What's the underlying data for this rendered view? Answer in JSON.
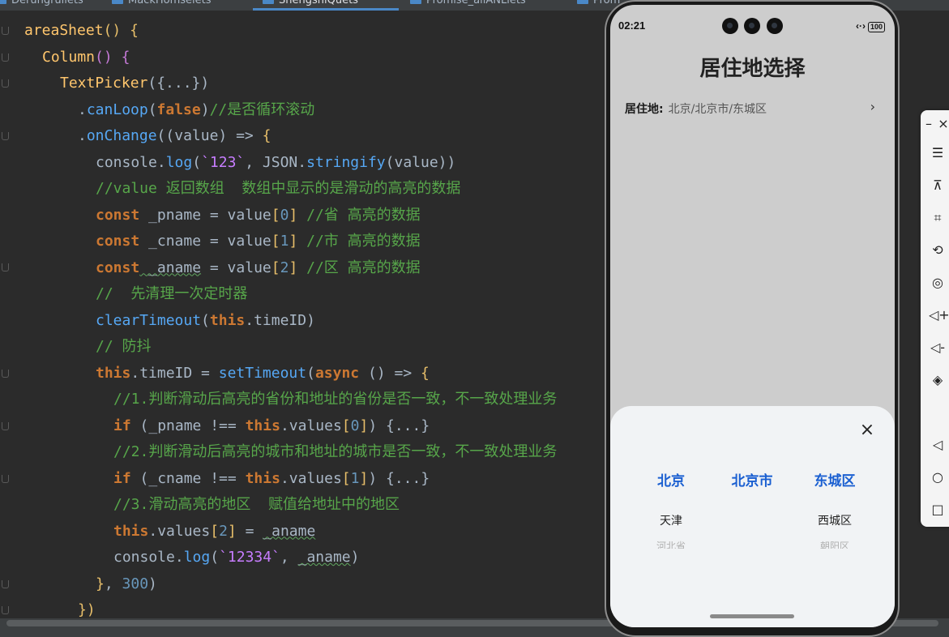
{
  "editor": {
    "tabs": [
      {
        "label": "Derungruilets"
      },
      {
        "label": "MackHomselets"
      },
      {
        "label": "ShengshiQuets"
      },
      {
        "label": "Promise_allANLlets"
      },
      {
        "label": "Prom"
      }
    ],
    "lines": [
      {
        "indent": 1,
        "tokens": [
          [
            "fn",
            "areaSheet"
          ],
          [
            "br1",
            "()"
          ],
          [
            "",
            " "
          ],
          [
            "br1",
            "{"
          ]
        ]
      },
      {
        "indent": 2,
        "tokens": [
          [
            "fn",
            "Column"
          ],
          [
            "br2",
            "()"
          ],
          [
            "",
            " "
          ],
          [
            "br2",
            "{"
          ]
        ]
      },
      {
        "indent": 3,
        "tokens": [
          [
            "fn",
            "TextPicker"
          ],
          [
            "",
            "({...})"
          ]
        ]
      },
      {
        "indent": 4,
        "tokens": [
          [
            "",
            "."
          ],
          [
            "mth",
            "canLoop"
          ],
          [
            "",
            "("
          ],
          [
            "kw",
            "false"
          ],
          [
            "",
            ")"
          ],
          [
            "cm",
            "//是否循环滚动"
          ]
        ]
      },
      {
        "indent": 4,
        "tokens": [
          [
            "",
            "."
          ],
          [
            "mth",
            "onChange"
          ],
          [
            "",
            "(("
          ],
          [
            "",
            "value"
          ],
          [
            "",
            ") => "
          ],
          [
            "br1",
            "{"
          ]
        ]
      },
      {
        "indent": 5,
        "tokens": [
          [
            "",
            "console."
          ],
          [
            "mth",
            "log"
          ],
          [
            "",
            "("
          ],
          [
            "str",
            "`123`"
          ],
          [
            "",
            ", JSON."
          ],
          [
            "mth",
            "stringify"
          ],
          [
            "",
            "(value))"
          ]
        ]
      },
      {
        "indent": 5,
        "tokens": [
          [
            "cm",
            "//value 返回数组  数组中显示的是滑动的高亮的数据"
          ]
        ]
      },
      {
        "indent": 5,
        "tokens": [
          [
            "kw",
            "const"
          ],
          [
            "",
            " _pname = value"
          ],
          [
            "br1",
            "["
          ],
          [
            "num",
            "0"
          ],
          [
            "br1",
            "]"
          ],
          [
            "",
            " "
          ],
          [
            "cm",
            "//省 高亮的数据"
          ]
        ]
      },
      {
        "indent": 5,
        "tokens": [
          [
            "kw",
            "const"
          ],
          [
            "",
            " _cname = value"
          ],
          [
            "br1",
            "["
          ],
          [
            "num",
            "1"
          ],
          [
            "br1",
            "]"
          ],
          [
            "",
            " "
          ],
          [
            "cm",
            "//市 高亮的数据"
          ]
        ]
      },
      {
        "indent": 5,
        "tokens": [
          [
            "kw",
            "const"
          ],
          [
            "squig",
            " _aname"
          ],
          [
            "",
            " = value"
          ],
          [
            "br1",
            "["
          ],
          [
            "num",
            "2"
          ],
          [
            "br1",
            "]"
          ],
          [
            "",
            " "
          ],
          [
            "cm",
            "//区 高亮的数据"
          ]
        ]
      },
      {
        "indent": 5,
        "tokens": [
          [
            "cm",
            "//  先清理一次定时器"
          ]
        ]
      },
      {
        "indent": 5,
        "tokens": [
          [
            "mth",
            "clearTimeout"
          ],
          [
            "",
            "("
          ],
          [
            "kw",
            "this"
          ],
          [
            "",
            ".timeID)"
          ]
        ]
      },
      {
        "indent": 5,
        "tokens": [
          [
            "cm",
            "// 防抖"
          ]
        ]
      },
      {
        "indent": 5,
        "tokens": [
          [
            "kw",
            "this"
          ],
          [
            "",
            ".timeID = "
          ],
          [
            "mth",
            "setTimeout"
          ],
          [
            "",
            "("
          ],
          [
            "kw",
            "async"
          ],
          [
            "",
            " () => "
          ],
          [
            "br1",
            "{"
          ]
        ]
      },
      {
        "indent": 6,
        "tokens": [
          [
            "cm",
            "//1.判断滑动后高亮的省份和地址的省份是否一致，不一致处理业务"
          ]
        ]
      },
      {
        "indent": 6,
        "tokens": [
          [
            "kw",
            "if"
          ],
          [
            "",
            " (_pname !== "
          ],
          [
            "kw",
            "this"
          ],
          [
            "",
            ".values"
          ],
          [
            "br1",
            "["
          ],
          [
            "num",
            "0"
          ],
          [
            "br1",
            "]"
          ],
          [
            "",
            ") {...}"
          ]
        ]
      },
      {
        "indent": 6,
        "tokens": [
          [
            "cm",
            "//2.判断滑动后高亮的城市和地址的城市是否一致，不一致处理业务"
          ]
        ]
      },
      {
        "indent": 6,
        "tokens": [
          [
            "kw",
            "if"
          ],
          [
            "",
            " (_cname !== "
          ],
          [
            "kw",
            "this"
          ],
          [
            "",
            ".values"
          ],
          [
            "br1",
            "["
          ],
          [
            "num",
            "1"
          ],
          [
            "br1",
            "]"
          ],
          [
            "",
            ") {...}"
          ]
        ]
      },
      {
        "indent": 6,
        "tokens": [
          [
            "cm",
            "//3.滑动高亮的地区  赋值给地址中的地区"
          ]
        ]
      },
      {
        "indent": 6,
        "tokens": [
          [
            "kw",
            "this"
          ],
          [
            "",
            ".values"
          ],
          [
            "br1",
            "["
          ],
          [
            "num",
            "2"
          ],
          [
            "br1",
            "]"
          ],
          [
            "",
            " = "
          ],
          [
            "squig",
            "_aname"
          ]
        ]
      },
      {
        "indent": 6,
        "tokens": [
          [
            "",
            "console."
          ],
          [
            "mth",
            "log"
          ],
          [
            "",
            "("
          ],
          [
            "str",
            "`12334`"
          ],
          [
            "",
            ", "
          ],
          [
            "squig",
            "_aname"
          ],
          [
            "",
            ")"
          ]
        ]
      },
      {
        "indent": 5,
        "tokens": [
          [
            "br1",
            "}"
          ],
          [
            "",
            ", "
          ],
          [
            "num",
            "300"
          ],
          [
            "",
            ")"
          ]
        ]
      },
      {
        "indent": 4,
        "tokens": [
          [
            "br1",
            "})"
          ]
        ]
      }
    ]
  },
  "phone": {
    "time": "02:21",
    "signal": "‹·›",
    "battery": "100",
    "title": "居住地选择",
    "address_label": "居住地:",
    "address_value": "北京/北京市/东城区",
    "arrow": "›",
    "close": "×",
    "picker": {
      "columns": [
        {
          "selected": "北京",
          "next1": "天津",
          "next2": "河北省"
        },
        {
          "selected": "北京市",
          "next1": "",
          "next2": ""
        },
        {
          "selected": "东城区",
          "next1": "西城区",
          "next2": "朝阳区"
        }
      ]
    }
  },
  "colors": {
    "accent": "#1a5fd1",
    "editor_bg": "#2b2b2b",
    "sheet_bg": "#f1f3f5"
  },
  "sidebar_icons": [
    "minimize-icon",
    "close-icon",
    "menu-icon",
    "pin-icon",
    "crop-icon",
    "rotate-icon",
    "screenshot-icon",
    "volume-up-icon",
    "volume-down-icon",
    "shake-icon",
    "back-icon",
    "home-icon",
    "recents-icon"
  ]
}
